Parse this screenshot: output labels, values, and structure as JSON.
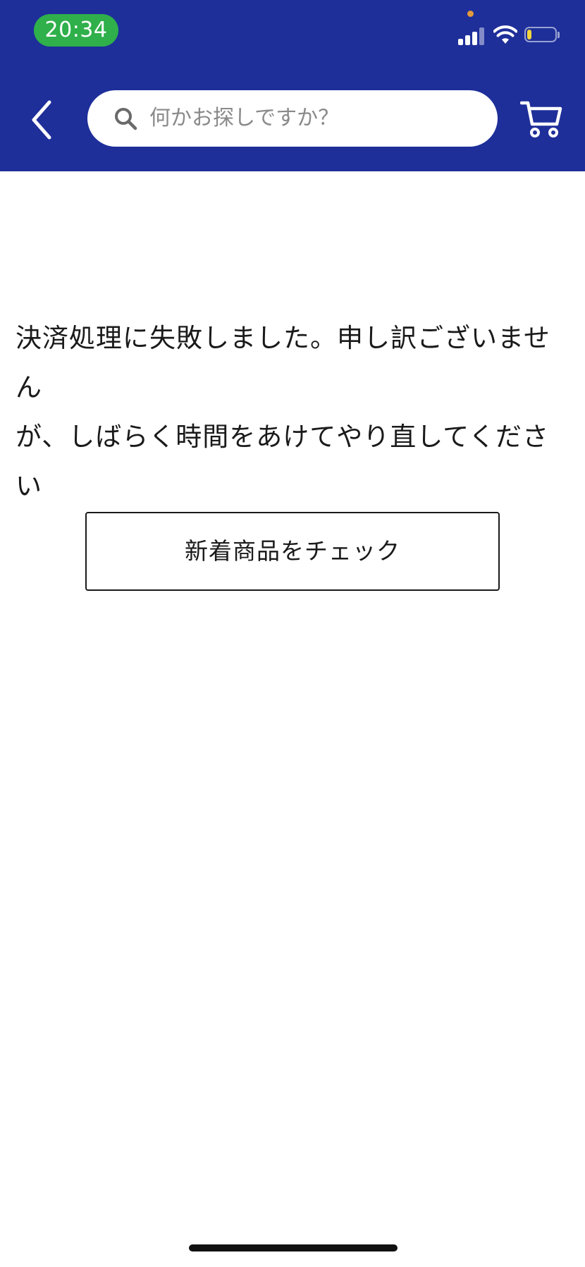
{
  "status_bar": {
    "time": "20:34",
    "battery_level": 0.15,
    "signal_bars_active": 3,
    "colors": {
      "time_pill": "#2fb04a",
      "battery_fill": "#f3d43c",
      "privacy_dot": "#e39a3b"
    }
  },
  "app_bar": {
    "background": "#1e2f9a",
    "back_icon": "chevron-left-icon",
    "search": {
      "placeholder": "何かお探しですか？",
      "icon": "search-icon"
    },
    "cart_icon": "cart-icon"
  },
  "main": {
    "message_line1": "決済処理に失敗しました。申し訳ございません",
    "message_line2": "が、しばらく時間をあけてやり直してください",
    "cta_label": "新着商品をチェック"
  }
}
